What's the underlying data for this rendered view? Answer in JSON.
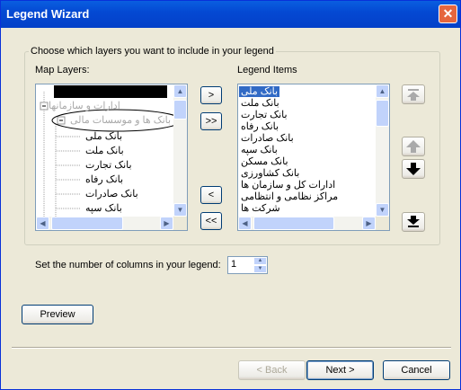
{
  "window": {
    "title": "Legend Wizard"
  },
  "group_label": "Choose which layers you want to include in your legend",
  "map_layers": {
    "label": "Map Layers:",
    "items": [
      {
        "text": "",
        "kind": "black-bar"
      },
      {
        "text": "ادارات و سازمانها",
        "kind": "collapsed-gray"
      },
      {
        "text": "بانک ها و موسسات مالی",
        "kind": "group-gray"
      },
      {
        "text": "بانک ملی",
        "kind": "child"
      },
      {
        "text": "بانک ملت",
        "kind": "child"
      },
      {
        "text": "بانک تجارت",
        "kind": "child"
      },
      {
        "text": "بانک رفاه",
        "kind": "child"
      },
      {
        "text": "بانک صادرات",
        "kind": "child"
      },
      {
        "text": "بانک سپه",
        "kind": "child"
      }
    ]
  },
  "legend_items": {
    "label": "Legend Items",
    "items": [
      "بانک ملی",
      "بانک ملت",
      "بانک تجارت",
      "بانک رفاه",
      "بانک صادرات",
      "بانک سپه",
      "بانک مسکن",
      "بانک کشاورزی",
      "ادارات کل و سازمان ها",
      "مراکز نظامی و انتظامی",
      "شرکت ها"
    ],
    "selected_index": 0
  },
  "transfer_buttons": {
    "add": ">",
    "add_all": ">>",
    "remove": "<",
    "remove_all": "<<"
  },
  "columns": {
    "label": "Set the number of columns in your legend:",
    "value": "1"
  },
  "buttons": {
    "preview": "Preview",
    "back": "< Back",
    "next": "Next >",
    "cancel": "Cancel"
  },
  "colors": {
    "titlebar": "#0449d3",
    "selection": "#316ac5",
    "face": "#ece9d8"
  }
}
